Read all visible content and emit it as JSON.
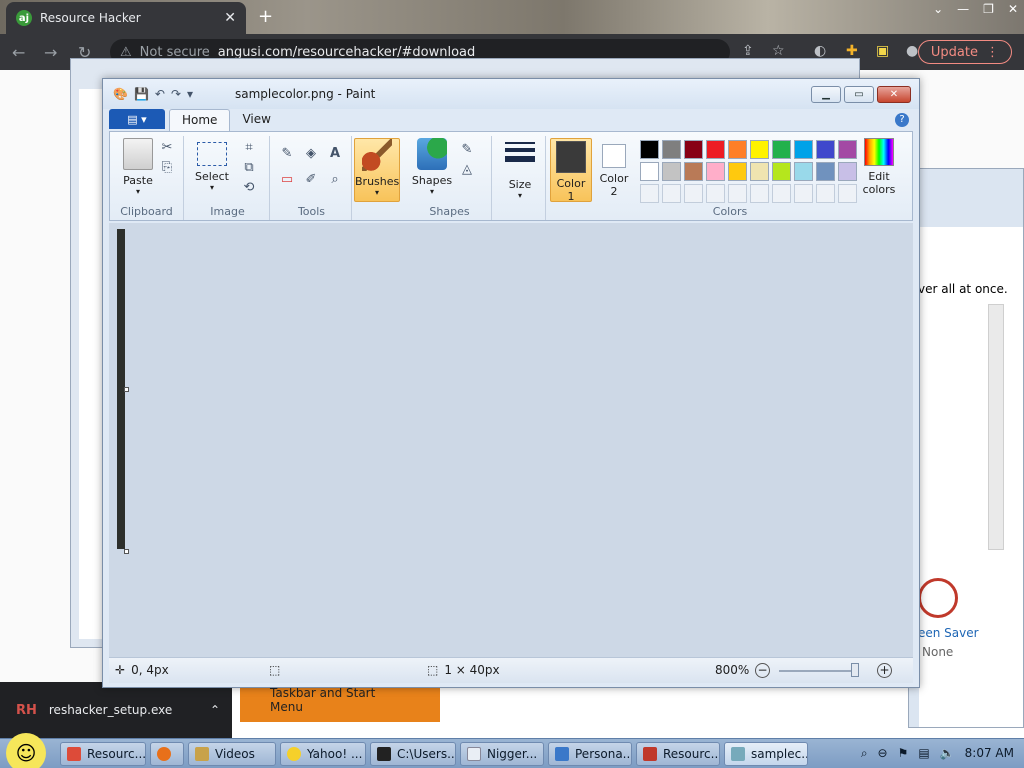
{
  "browser": {
    "tab_title": "Resource Hacker",
    "tab_favicon": "aj",
    "url_security": "Not secure",
    "url_text": "angusi.com/resourcehacker/#download",
    "update_label": "Update"
  },
  "background": {
    "right_text": "ver all at once.",
    "screen_saver_label": "een Saver",
    "none_label": "None",
    "orange_label": "Taskbar and Start Menu",
    "download_item": "reshacker_setup.exe",
    "download_icon": "RH"
  },
  "paint": {
    "title": "samplecolor.png - Paint",
    "tabs": [
      "Home",
      "View"
    ],
    "groups": {
      "clipboard": "Clipboard",
      "image": "Image",
      "tools": "Tools",
      "shapes": "Shapes",
      "colors": "Colors"
    },
    "buttons": {
      "paste": "Paste",
      "select": "Select",
      "brushes": "Brushes",
      "shapes": "Shapes",
      "size": "Size",
      "color1": "Color",
      "color1_num": "1",
      "color2": "Color",
      "color2_num": "2",
      "edit_colors": "Edit colors"
    },
    "palette_row1": [
      "#000000",
      "#7f7f7f",
      "#880015",
      "#ed1c24",
      "#ff7f27",
      "#fff200",
      "#22b14c",
      "#00a2e8",
      "#3f48cc",
      "#a349a4"
    ],
    "palette_row2": [
      "#ffffff",
      "#c3c3c3",
      "#b97a57",
      "#ffaec9",
      "#ffc90e",
      "#efe4b0",
      "#b5e61d",
      "#99d9ea",
      "#7092be",
      "#c8bfe7"
    ],
    "color1_value": "#3a3a3a",
    "color2_value": "#ffffff",
    "status": {
      "position": "0, 4px",
      "size": "1 × 40px",
      "zoom": "800%"
    }
  },
  "taskbar": {
    "items": [
      "Resourc...",
      "",
      "Videos",
      "Yahoo! ...",
      "C:\\Users...",
      "Nigger...",
      "Persona...",
      "Resourc...",
      "samplec..."
    ],
    "clock": "8:07 AM"
  }
}
